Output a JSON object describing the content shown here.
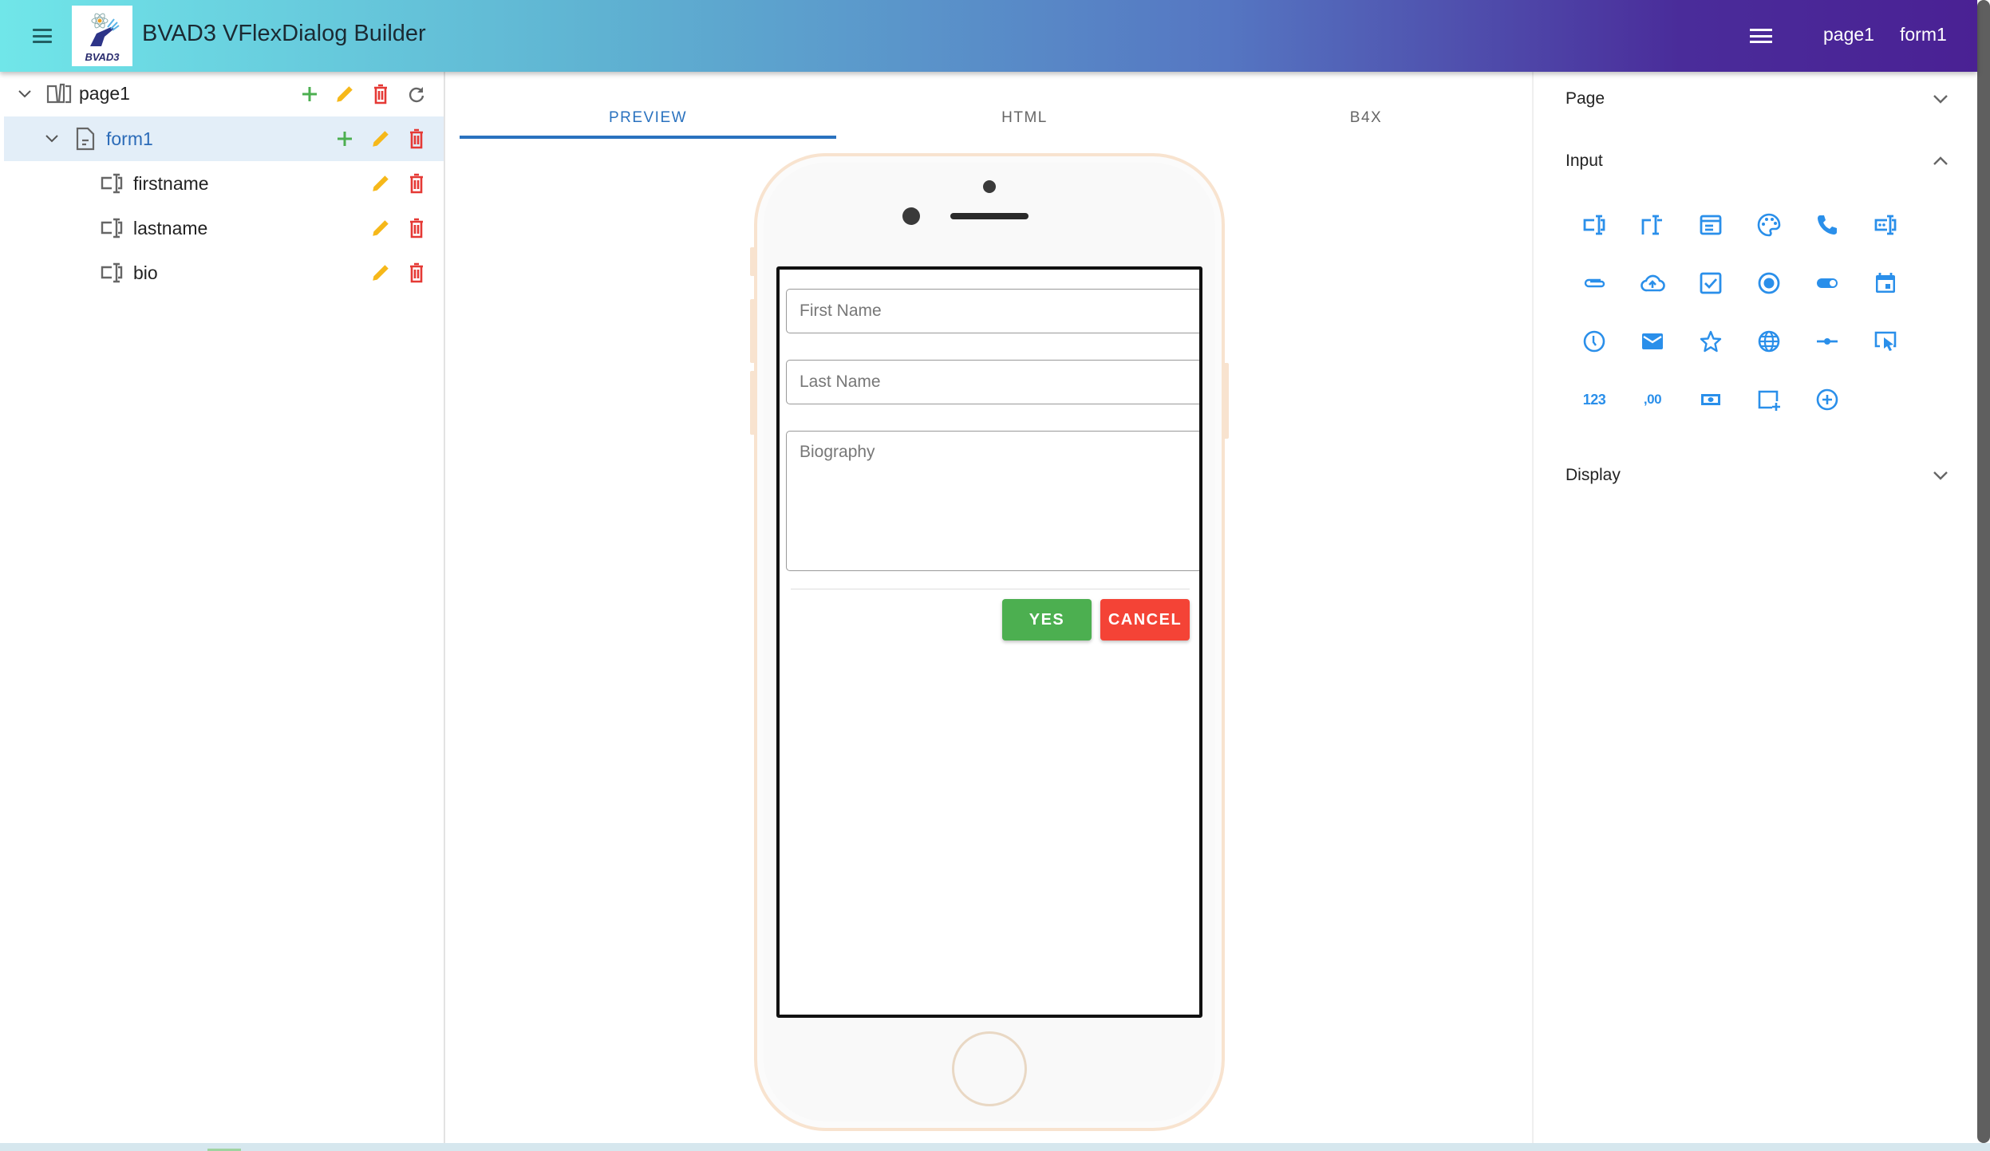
{
  "app": {
    "title": "BVAD3 VFlexDialog Builder",
    "logo_text": "BVAD3",
    "header_links": [
      "page1",
      "form1"
    ]
  },
  "colors": {
    "accent": "#2a72bf",
    "add": "#4caf50",
    "edit": "#f6b819",
    "delete": "#e53935",
    "icon_blue": "#2a8fea",
    "yes_button": "#4caf50",
    "cancel_button": "#f44336"
  },
  "tree": {
    "page": {
      "label": "page1",
      "icon": "book-open-icon",
      "actions": [
        "add",
        "edit",
        "delete",
        "refresh"
      ]
    },
    "form": {
      "label": "form1",
      "icon": "file-document-icon",
      "actions": [
        "add",
        "edit",
        "delete"
      ],
      "selected": true
    },
    "fields": [
      {
        "label": "firstname",
        "icon": "textbox-icon",
        "actions": [
          "edit",
          "delete"
        ]
      },
      {
        "label": "lastname",
        "icon": "textbox-icon",
        "actions": [
          "edit",
          "delete"
        ]
      },
      {
        "label": "bio",
        "icon": "textbox-icon",
        "actions": [
          "edit",
          "delete"
        ]
      }
    ]
  },
  "tabs": [
    {
      "label": "PREVIEW",
      "active": true
    },
    {
      "label": "HTML",
      "active": false
    },
    {
      "label": "B4X",
      "active": false
    }
  ],
  "preview": {
    "fields": [
      {
        "placeholder": "First Name",
        "value": ""
      },
      {
        "placeholder": "Last Name",
        "value": ""
      },
      {
        "placeholder": "Biography",
        "value": ""
      }
    ],
    "buttons": {
      "yes": "YES",
      "cancel": "CANCEL"
    }
  },
  "right_panel": {
    "sections": [
      {
        "label": "Page",
        "expanded": false
      },
      {
        "label": "Input",
        "expanded": true
      },
      {
        "label": "Display",
        "expanded": false
      }
    ],
    "input_tools": [
      "textfield-icon",
      "textarea-icon",
      "select-icon",
      "color-palette-icon",
      "phone-icon",
      "password-icon",
      "file-attach-icon",
      "cloud-upload-icon",
      "checkbox-icon",
      "radio-icon",
      "switch-icon",
      "calendar-icon",
      "clock-icon",
      "email-icon",
      "star-rating-icon",
      "globe-url-icon",
      "slider-icon",
      "cursor-select-icon",
      "number-icon",
      "decimal-icon",
      "money-icon",
      "add-box-icon",
      "add-circle-icon"
    ],
    "input_tool_text": {
      "number-icon": "123",
      "decimal-icon": ",00"
    }
  }
}
